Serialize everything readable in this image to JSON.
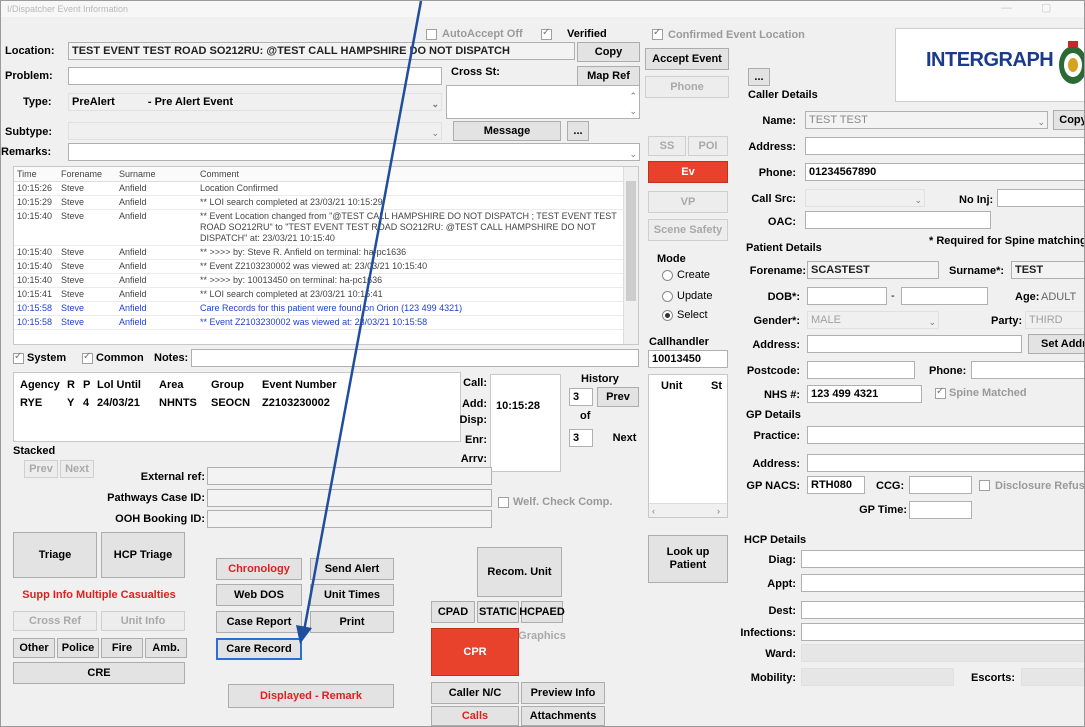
{
  "window": {
    "title": "I/Dispatcher Event Information"
  },
  "top": {
    "location_label": "Location:",
    "location_value": "TEST EVENT TEST ROAD SO212RU: @TEST CALL HAMPSHIRE DO NOT DISPATCH",
    "copy_label": "Copy",
    "autoaccept_label": "AutoAccept Off",
    "verified_label": "Verified",
    "accept_event_label": "Accept Event",
    "confirmed_location_label": "Confirmed Event Location",
    "logo_text": "INTERGRAPH",
    "problem_label": "Problem:",
    "cross_st_label": "Cross St:",
    "map_ref_label": "Map Ref",
    "phone_label": "Phone",
    "type_label": "Type:",
    "type_value": "PreAlert",
    "type_desc": "- Pre Alert Event",
    "subtype_label": "Subtype:",
    "message_label": "Message",
    "ellipsis": "...",
    "remarks_label": "Remarks:"
  },
  "side_buttons": {
    "ss": "SS",
    "poi": "POI",
    "ev": "Ev",
    "vp": "VP",
    "scene_safety": "Scene Safety",
    "mode_label": "Mode",
    "create": "Create",
    "update": "Update",
    "select": "Select",
    "callhandler_label": "Callhandler",
    "callhandler_value": "10013450",
    "unit_col": "Unit",
    "st_col": "St",
    "look_up_patient": "Look up Patient"
  },
  "log": {
    "headers": [
      "Time",
      "Forename",
      "Surname",
      "Comment"
    ],
    "rows": [
      [
        "10:15:26",
        "Steve",
        "Anfield",
        "Location Confirmed"
      ],
      [
        "10:15:29",
        "Steve",
        "Anfield",
        "** LOI search completed at 23/03/21 10:15:29"
      ],
      [
        "10:15:40",
        "Steve",
        "Anfield",
        "** Event Location changed from \"@TEST CALL HAMPSHIRE DO NOT DISPATCH ; TEST EVENT TEST ROAD SO212RU\" to \"TEST EVENT TEST ROAD SO212RU: @TEST CALL HAMPSHIRE DO NOT DISPATCH\" at: 23/03/21 10:15:40"
      ],
      [
        "10:15:40",
        "Steve",
        "Anfield",
        "** >>>> by: Steve R. Anfield on terminal: ha-pc1636"
      ],
      [
        "10:15:40",
        "Steve",
        "Anfield",
        "** Event Z2103230002 was viewed at: 23/03/21 10:15:40"
      ],
      [
        "10:15:40",
        "Steve",
        "Anfield",
        "** >>>> by: 10013450 on terminal: ha-pc1636"
      ],
      [
        "10:15:41",
        "Steve",
        "Anfield",
        "** LOI search completed at 23/03/21 10:15:41"
      ],
      [
        "10:15:58",
        "Steve",
        "Anfield",
        "Care Records for this patient were found on Orion (123 499 4321)"
      ],
      [
        "10:15:58",
        "Steve",
        "Anfield",
        "** Event Z2103230002 was viewed at: 23/03/21 10:15:58"
      ]
    ]
  },
  "notes": {
    "system_label": "System",
    "common_label": "Common",
    "notes_label": "Notes:"
  },
  "agency": {
    "headers": [
      "Agency",
      "R",
      "P",
      "Lol Until",
      "Area",
      "Group",
      "Event Number"
    ],
    "row": [
      "RYE",
      "Y",
      "4",
      "24/03/21",
      "NHNTS",
      "SEOCN",
      "Z2103230002"
    ]
  },
  "times": {
    "call_label": "Call:",
    "add_label": "Add:",
    "add_value": "10:15:28",
    "disp_label": "Disp:",
    "enr_label": "Enr:",
    "arrv_label": "Arrv:",
    "history_label": "History",
    "history_value": "3",
    "of_label": "of",
    "of_value": "3",
    "prev": "Prev",
    "next": "Next"
  },
  "stacked": {
    "label": "Stacked",
    "prev": "Prev",
    "next": "Next",
    "external_ref_label": "External ref:",
    "pathways_label": "Pathways Case ID:",
    "ooh_label": "OOH Booking ID:",
    "welf_check_label": "Welf. Check Comp."
  },
  "bottom_buttons": {
    "triage": "Triage",
    "hcp_triage": "HCP Triage",
    "supp_info": "Supp Info Multiple Casualties",
    "cross_ref": "Cross Ref",
    "unit_info": "Unit Info",
    "other": "Other",
    "police": "Police",
    "fire": "Fire",
    "amb": "Amb.",
    "cre": "CRE",
    "chronology": "Chronology",
    "send_alert": "Send Alert",
    "web_dos": "Web DOS",
    "unit_times": "Unit Times",
    "case_report": "Case Report",
    "print": "Print",
    "care_record": "Care Record",
    "displayed_remark": "Displayed - Remark",
    "recom_unit": "Recom. Unit",
    "cpad": "CPAD",
    "static": "STATIC",
    "hcpaed": "HCPAED",
    "graphics": "Graphics",
    "cpr": "CPR",
    "caller_nc": "Caller N/C",
    "preview_info": "Preview Info",
    "calls": "Calls",
    "attachments": "Attachments"
  },
  "caller": {
    "section": "Caller Details",
    "name_label": "Name:",
    "name_value": "TEST TEST",
    "copy": "Copy",
    "address_label": "Address:",
    "phone_label": "Phone:",
    "phone_value": "01234567890",
    "call_src_label": "Call Src:",
    "no_inj_label": "No Inj:",
    "oac_label": "OAC:"
  },
  "patient": {
    "section": "Patient Details",
    "required_note": "* Required for Spine matching",
    "forename_label": "Forename:",
    "forename_value": "SCASTEST",
    "surname_label": "Surname*:",
    "surname_value": "TEST",
    "dob_label": "DOB*:",
    "age_label": "Age:",
    "age_value": "ADULT",
    "gender_label": "Gender*:",
    "gender_value": "MALE",
    "party_label": "Party:",
    "party_value": "THIRD",
    "address_label": "Address:",
    "set_address": "Set Address",
    "postcode_label": "Postcode:",
    "phone_label": "Phone:",
    "nhs_label": "NHS #:",
    "nhs_value": "123 499 4321",
    "spine_matched": "Spine Matched"
  },
  "gp": {
    "section": "GP Details",
    "practice_label": "Practice:",
    "address_label": "Address:",
    "nacs_label": "GP NACS:",
    "nacs_value": "RTH080",
    "ccg_label": "CCG:",
    "disclosure_label": "Disclosure Refused",
    "gp_time_label": "GP Time:"
  },
  "hcp": {
    "section": "HCP Details",
    "diag_label": "Diag:",
    "appt_label": "Appt:",
    "dest_label": "Dest:",
    "infections_label": "Infections:",
    "ward_label": "Ward:",
    "mobility_label": "Mobility:",
    "escorts_label": "Escorts:"
  }
}
